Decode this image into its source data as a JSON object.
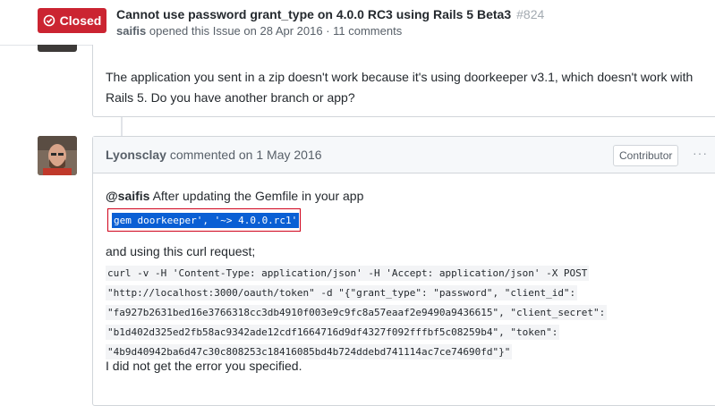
{
  "issue": {
    "state_label": "Closed",
    "title": "Cannot use password grant_type on 4.0.0 RC3 using Rails 5 Beta3",
    "number": "#824",
    "author": "saifis",
    "meta_text": "opened this Issue on 28 Apr 2016 · 11 comments",
    "state_color": "#cb2431"
  },
  "comments": [
    {
      "body": "The application you sent in a zip doesn't work because it's using doorkeeper v3.1, which doesn't work with Rails 5. Do you have another branch or app?"
    },
    {
      "author": "Lyonsclay",
      "action": "commented on 1 May 2016",
      "badge": "Contributor",
      "mention": "@saifis",
      "intro": " After updating the Gemfile in your app",
      "highlighted_code": "gem doorkeeper', '~> 4.0.0.rc1'",
      "curl_intro": "and using this curl request;",
      "curl_lines": [
        "curl -v -H 'Content-Type: application/json' -H 'Accept: application/json' -X POST",
        "\"http://localhost:3000/oauth/token\" -d \"{\"grant_type\": \"password\", \"client_id\":",
        "\"fa927b2631bed16e3766318cc3db4910f003e9c9fc8a57eaaf2e9490a9436615\", \"client_secret\":",
        "\"b1d402d325ed2fb58ac9342ade12cdf1664716d9df4327f092fffbf5c08259b4\", \"token\":",
        "\"4b9d40942ba6d47c30c808253c18416085bd4b724ddebd741114ac7ce74690fd\"}\""
      ],
      "closing": "I did not get the error you specified."
    }
  ]
}
